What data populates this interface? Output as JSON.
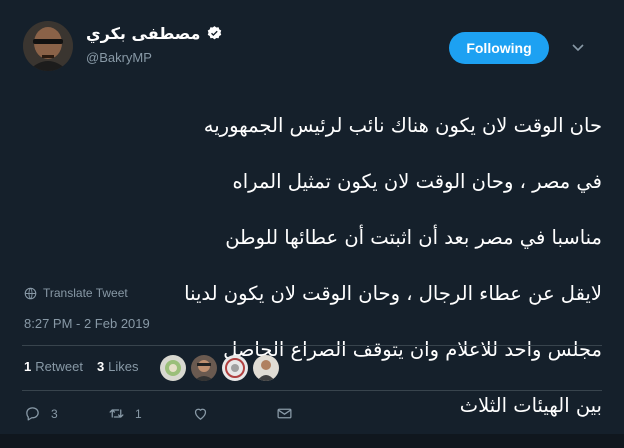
{
  "tweet": {
    "display_name": "مصطفى بكري",
    "handle": "@BakryMP",
    "follow_label": "Following",
    "lines": [
      "حان الوقت لان يكون هناك نائب لرئيس الجمهوريه",
      "في مصر ، وحان الوقت لان يكون تمثيل المراه",
      "مناسبا في مصر بعد أن اثبتت أن عطائها للوطن",
      "لايقل عن عطاء الرجال ، وحان الوقت لان يكون لدينا",
      "مجلس واحد للاعلام وان يتوقف الصراع الحاصل",
      "بين الهيئات الثلاث"
    ],
    "translate_label": "Translate Tweet",
    "timestamp": "8:27 PM - 2 Feb 2019",
    "stats": {
      "retweets_count": "1",
      "retweets_label": "Retweet",
      "likes_count": "3",
      "likes_label": "Likes"
    },
    "actions": {
      "reply_count": "3",
      "retweet_count": "1"
    }
  },
  "colors": {
    "background": "#15202b",
    "accent": "#1da1f2",
    "muted": "#8899a6",
    "divider": "#38444d"
  }
}
